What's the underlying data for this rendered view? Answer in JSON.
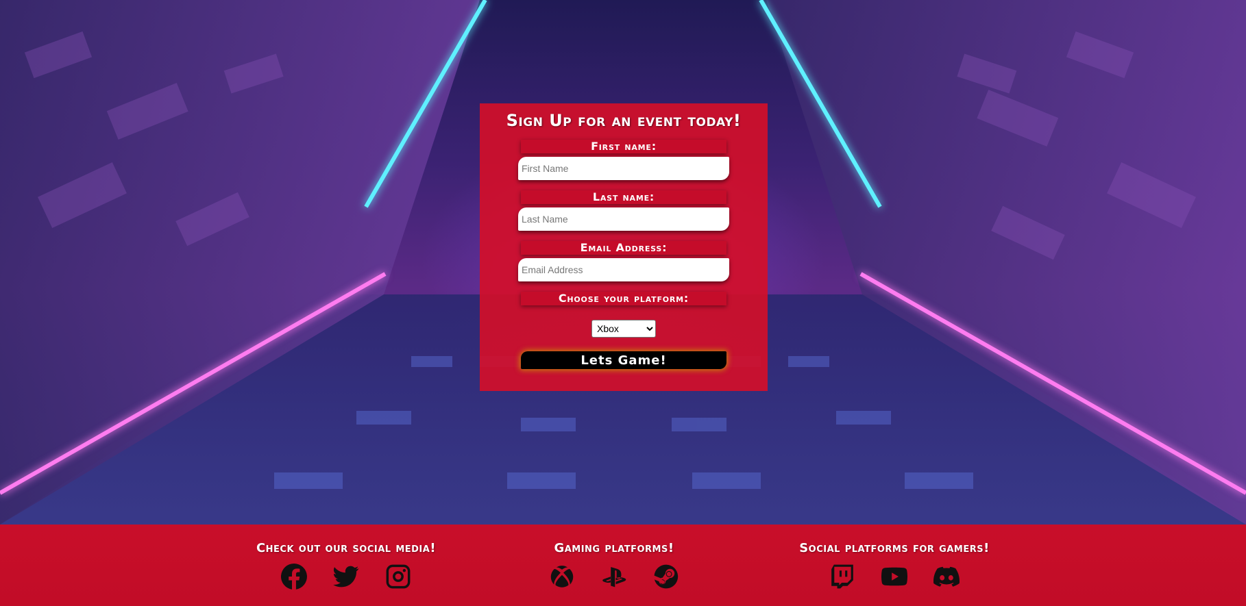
{
  "form": {
    "title": "Sign Up for an event today!",
    "first_name_label": "First name:",
    "first_name_placeholder": "First Name",
    "last_name_label": "Last name:",
    "last_name_placeholder": "Last Name",
    "email_label": "Email Address:",
    "email_placeholder": "Email Address",
    "platform_label": "Choose your platform:",
    "platform_selected": "Xbox",
    "submit_label": "Lets Game!"
  },
  "footer": {
    "social_heading": "Check out our social media!",
    "social_icons": [
      "facebook-icon",
      "twitter-icon",
      "instagram-icon"
    ],
    "gaming_heading": "Gaming platforms!",
    "gaming_icons": [
      "xbox-icon",
      "playstation-icon",
      "steam-icon"
    ],
    "gamer_social_heading": "Social platforms for gamers!",
    "gamer_social_icons": [
      "twitch-icon",
      "youtube-icon",
      "discord-icon"
    ]
  },
  "colors": {
    "form_background": "#d60e28",
    "label_background": "#c50c2a",
    "footer_background": "#d60e28",
    "button_background": "#000000",
    "button_glow": "#c8a000"
  }
}
